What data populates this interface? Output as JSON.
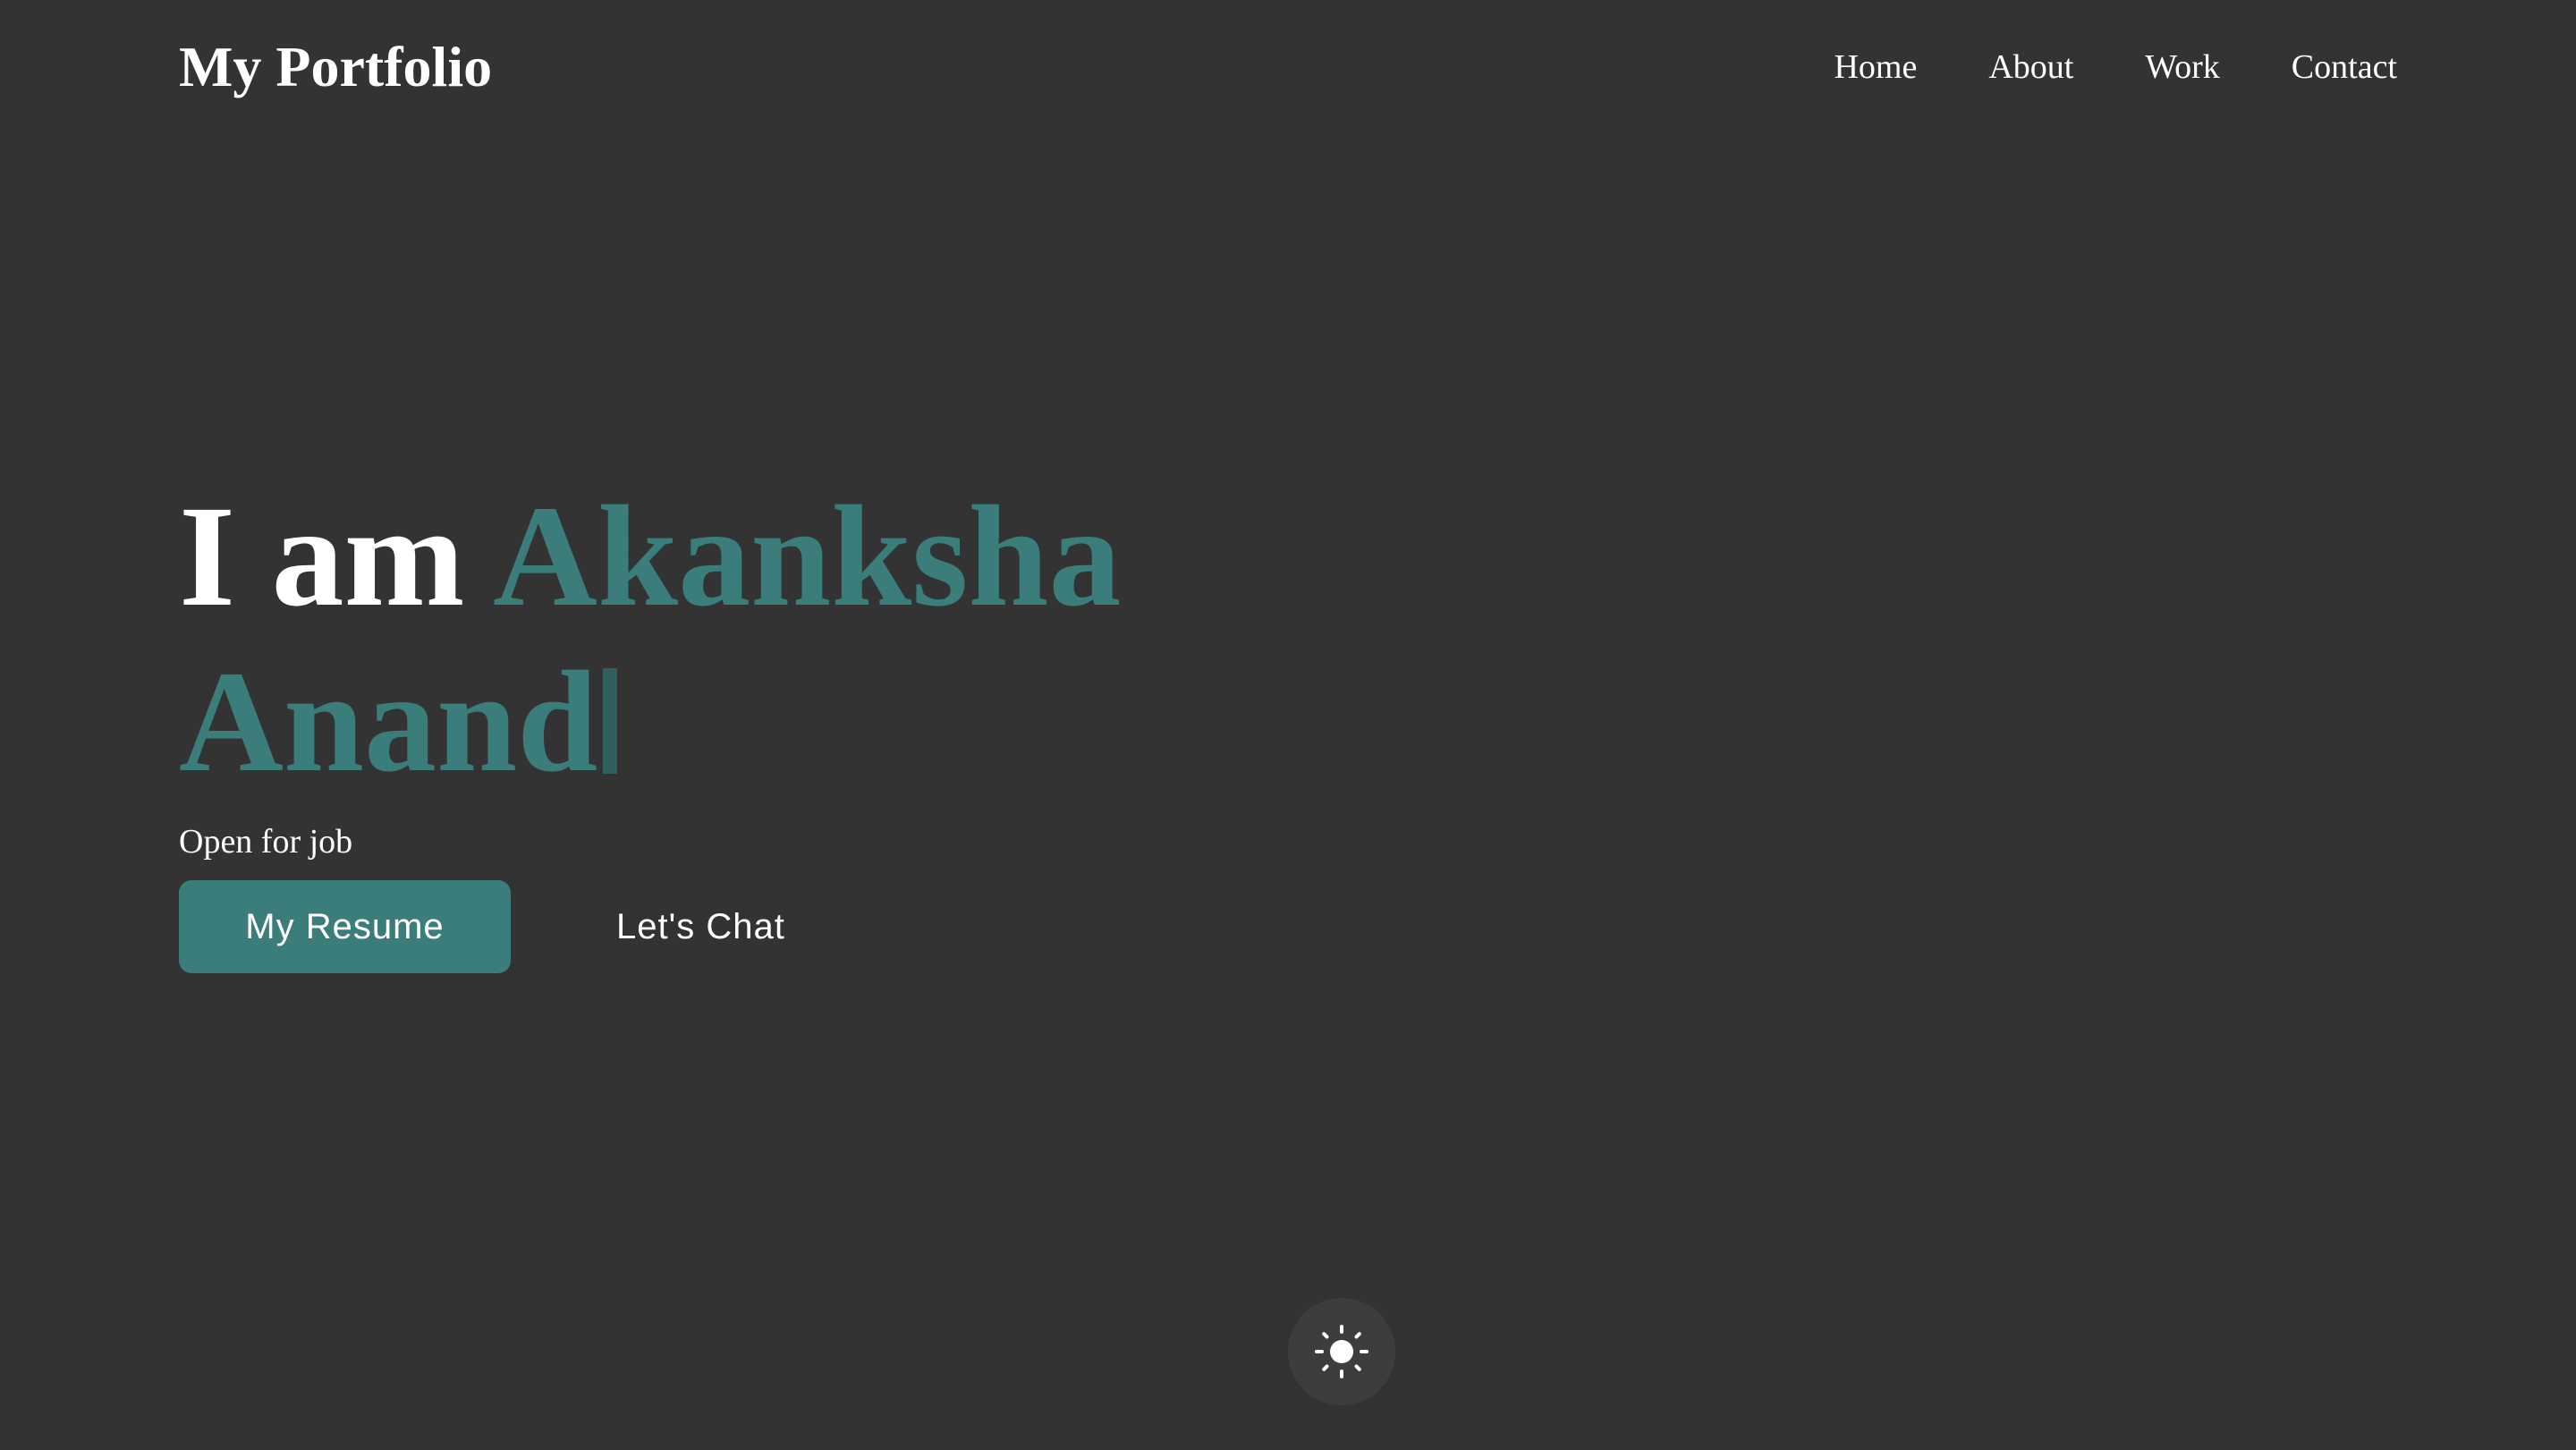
{
  "header": {
    "logo": "My Portfolio",
    "nav": [
      {
        "label": "Home"
      },
      {
        "label": "About"
      },
      {
        "label": "Work"
      },
      {
        "label": "Contact"
      }
    ]
  },
  "hero": {
    "lead": "I am",
    "name_line1": "Akanksha",
    "name_line2": "Anand",
    "tagline": "Open for job",
    "primary_button": "My Resume",
    "secondary_button": "Let's Chat"
  },
  "theme_toggle": {
    "icon": "sun-icon"
  },
  "colors": {
    "background": "#333333",
    "accent": "#3a7d7b",
    "text": "#ffffff",
    "toggle_background": "#3d3d3d"
  }
}
